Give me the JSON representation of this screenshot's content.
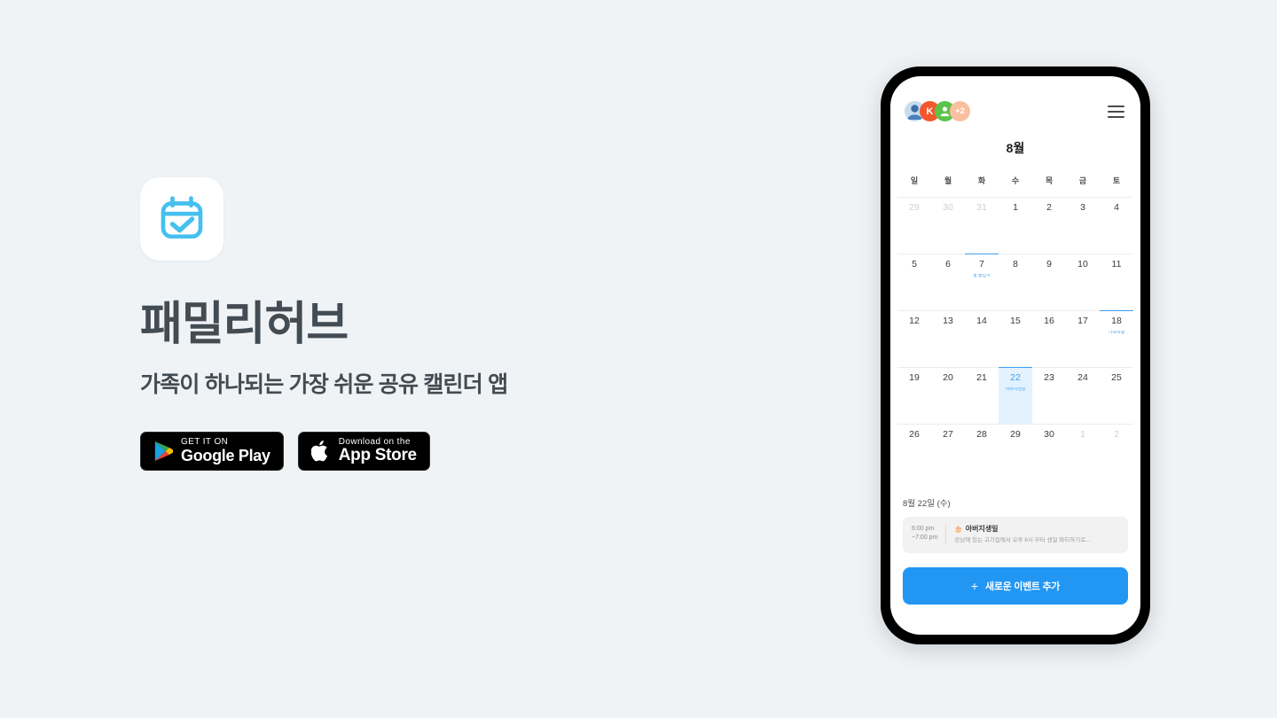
{
  "page": {
    "background_color": "#eff3f6"
  },
  "promo": {
    "app_icon_name": "calendar-check-icon",
    "icon_color": "#45c0ef",
    "title": "패밀리허브",
    "tagline": "가족이 하나되는 가장 쉬운 공유 캘린더 앱",
    "badges": [
      {
        "id": "google-play",
        "icon": "google-play-icon",
        "small_text": "GET IT ON",
        "big_text": "Google Play"
      },
      {
        "id": "app-store",
        "icon": "apple-logo-icon",
        "small_text": "Download on the",
        "big_text": "App Store"
      }
    ]
  },
  "phone": {
    "app_bar": {
      "menu_icon": "hamburger-menu-icon",
      "avatars": [
        {
          "type": "photo",
          "label": "",
          "color": "#dbe6f0"
        },
        {
          "type": "initial",
          "label": "K",
          "color": "#f4572c"
        },
        {
          "type": "person",
          "label": "",
          "color": "#5ec24a"
        },
        {
          "type": "overflow",
          "label": "+2",
          "color": "#f9c0a0"
        }
      ]
    },
    "calendar": {
      "month": "8월",
      "weekdays": [
        "일",
        "월",
        "화",
        "수",
        "목",
        "금",
        "토"
      ],
      "accent_color": "#3d9ef0",
      "days": [
        {
          "n": "29",
          "muted": true,
          "event": ""
        },
        {
          "n": "30",
          "muted": true,
          "event": ""
        },
        {
          "n": "31",
          "muted": true,
          "event": ""
        },
        {
          "n": "1",
          "muted": false,
          "event": ""
        },
        {
          "n": "2",
          "muted": false,
          "event": ""
        },
        {
          "n": "3",
          "muted": false,
          "event": ""
        },
        {
          "n": "4",
          "muted": false,
          "event": ""
        },
        {
          "n": "5",
          "muted": false,
          "event": ""
        },
        {
          "n": "6",
          "muted": false,
          "event": ""
        },
        {
          "n": "7",
          "muted": false,
          "event": "딸 졸업식"
        },
        {
          "n": "8",
          "muted": false,
          "event": ""
        },
        {
          "n": "9",
          "muted": false,
          "event": ""
        },
        {
          "n": "10",
          "muted": false,
          "event": ""
        },
        {
          "n": "11",
          "muted": false,
          "event": ""
        },
        {
          "n": "12",
          "muted": false,
          "event": ""
        },
        {
          "n": "13",
          "muted": false,
          "event": ""
        },
        {
          "n": "14",
          "muted": false,
          "event": ""
        },
        {
          "n": "15",
          "muted": false,
          "event": ""
        },
        {
          "n": "16",
          "muted": false,
          "event": ""
        },
        {
          "n": "17",
          "muted": false,
          "event": ""
        },
        {
          "n": "18",
          "muted": false,
          "event": "가족여행"
        },
        {
          "n": "19",
          "muted": false,
          "event": ""
        },
        {
          "n": "20",
          "muted": false,
          "event": ""
        },
        {
          "n": "21",
          "muted": false,
          "event": ""
        },
        {
          "n": "22",
          "muted": false,
          "event": "아버지생일",
          "selected": true
        },
        {
          "n": "23",
          "muted": false,
          "event": ""
        },
        {
          "n": "24",
          "muted": false,
          "event": ""
        },
        {
          "n": "25",
          "muted": false,
          "event": ""
        },
        {
          "n": "26",
          "muted": false,
          "event": ""
        },
        {
          "n": "27",
          "muted": false,
          "event": ""
        },
        {
          "n": "28",
          "muted": false,
          "event": ""
        },
        {
          "n": "29",
          "muted": false,
          "event": ""
        },
        {
          "n": "30",
          "muted": false,
          "event": ""
        },
        {
          "n": "1",
          "muted": true,
          "event": ""
        },
        {
          "n": "2",
          "muted": true,
          "event": ""
        }
      ]
    },
    "selected_day": {
      "label": "8월 22일 (수)",
      "event": {
        "time_start": "6:00 pm",
        "time_end": "~7:00 pm",
        "emoji": "🎂",
        "title": "아버지생일",
        "description": "강남에 있는 고기집에서 오후 6시 부터 생일 파티하기로..."
      }
    },
    "add_button": {
      "plus": "+",
      "label": "새로운 이벤트 추가",
      "color": "#2196f3"
    }
  }
}
